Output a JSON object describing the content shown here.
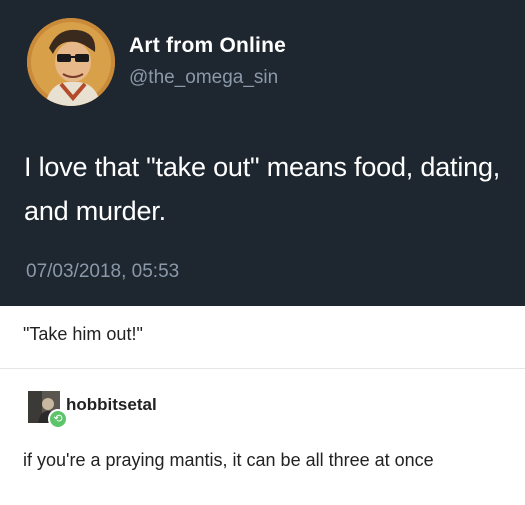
{
  "tweet": {
    "author_name": "Art from Online",
    "author_handle": "@the_omega_sin",
    "text": "I love that \"take out\" means food, dating, and murder.",
    "timestamp": "07/03/2018, 05:53"
  },
  "reply_1": {
    "text": "\"Take him out!\""
  },
  "reply_2": {
    "username": "hobbitsetal",
    "text": "if you're a praying mantis, it can be all three at once",
    "badge_icon": "reblog-icon"
  },
  "colors": {
    "tweet_background": "#1e2630",
    "secondary_text": "#8a98a8"
  }
}
